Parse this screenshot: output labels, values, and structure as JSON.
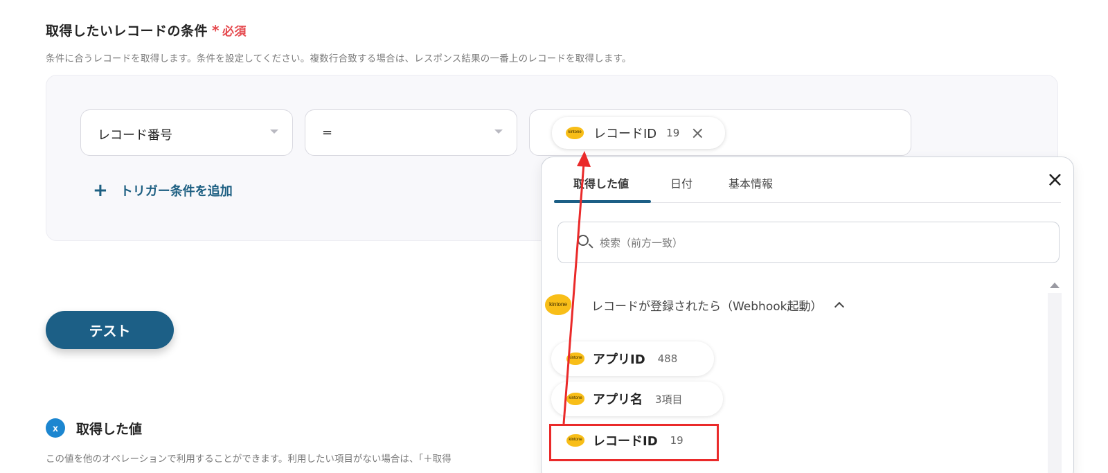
{
  "section": {
    "title": "取得したいレコードの条件",
    "required_star": "*",
    "required_label": "必須",
    "description": "条件に合うレコードを取得します。条件を設定してください。複数行合致する場合は、レスポンス結果の一番上のレコードを取得します。"
  },
  "condition": {
    "field_value": "レコード番号",
    "operator_value": "=",
    "value_chip": {
      "icon": "kintone-logo-icon",
      "logo_text": "kintone",
      "label": "レコードID",
      "number": "19",
      "remove": "×"
    },
    "add_trigger_plus": "+",
    "add_trigger_label": "トリガー条件を追加"
  },
  "test_button": "テスト",
  "obtained": {
    "icon": "x-icon",
    "icon_glyph": "x",
    "title": "取得した値",
    "description": "この値を他のオペレーションで利用することができます。利用したい項目がない場合は、「＋取得"
  },
  "picker": {
    "tabs": [
      {
        "label": "取得した値",
        "active": true
      },
      {
        "label": "日付",
        "active": false
      },
      {
        "label": "基本情報",
        "active": false
      }
    ],
    "close": "×",
    "search_placeholder": "検索（前方一致）",
    "group": {
      "icon": "kintone-logo-icon",
      "logo_text": "kintone",
      "label": "レコードが登録されたら（Webhook起動）"
    },
    "items": [
      {
        "label": "アプリID",
        "value": "488"
      },
      {
        "label": "アプリ名",
        "value": "3項目"
      },
      {
        "label": "レコードID",
        "value": "19"
      }
    ]
  },
  "colors": {
    "accent": "#1c5f86",
    "required": "#e5484d",
    "annotation": "#ea2a2a",
    "kintone": "#f8be18"
  }
}
